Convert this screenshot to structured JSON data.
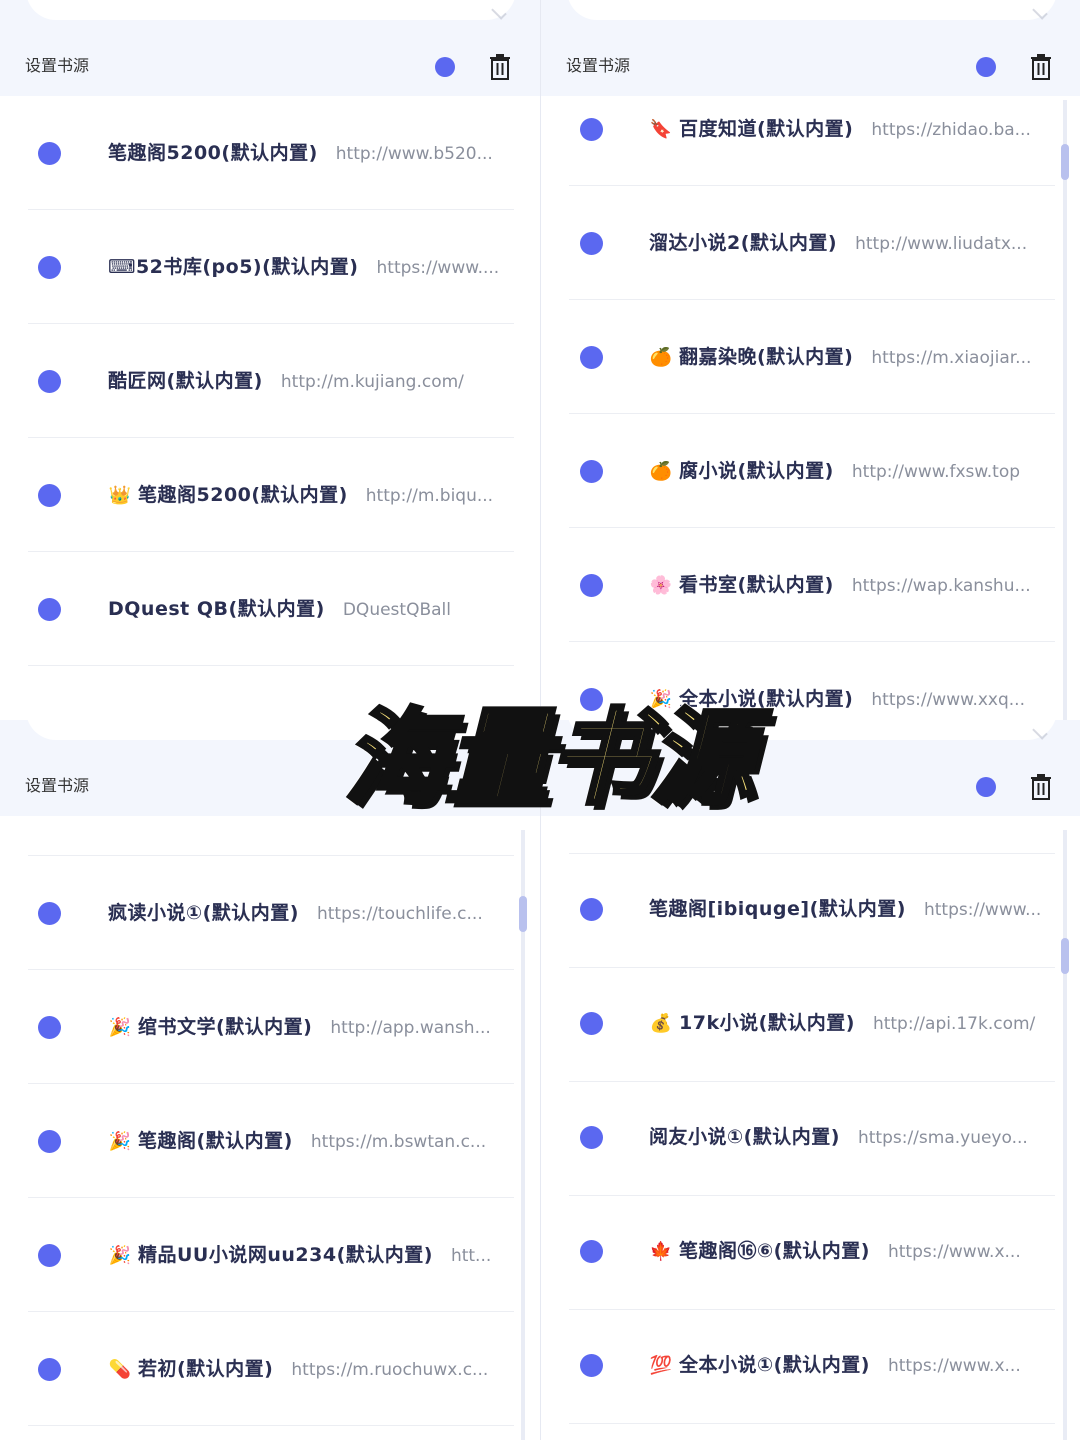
{
  "app": {
    "section_title": "设置书源"
  },
  "colors": {
    "accent": "#5b68f0",
    "header_bg": "#f3f6fd",
    "banner_fill": "#f9e27a"
  },
  "icons": {
    "delete": "trash-icon"
  },
  "banner": {
    "text": "海量书源"
  },
  "panels": [
    {
      "id": "top-left",
      "title": "设置书源",
      "rows": [
        {
          "icon": "",
          "name": "笔趣阁5200(默认内置)",
          "url": "http://www.b520..."
        },
        {
          "icon": "⌨",
          "name": "52书库(po5)(默认内置)",
          "url": "https://www...."
        },
        {
          "icon": "",
          "name": "酷匠网(默认内置)",
          "url": "http://m.kujiang.com/"
        },
        {
          "icon": "👑",
          "name": "笔趣阁5200(默认内置)",
          "url": "http://m.biqu..."
        },
        {
          "icon": "",
          "name": "DQuest QB(默认内置)",
          "url": "DQuestQBall"
        }
      ]
    },
    {
      "id": "top-right",
      "title": "设置书源",
      "rows": [
        {
          "icon": "🔖",
          "name": "百度知道(默认内置)",
          "url": "https://zhidao.ba..."
        },
        {
          "icon": "",
          "name": "溜达小说2(默认内置)",
          "url": "http://www.liudatx..."
        },
        {
          "icon": "🍊",
          "name": "翻嘉染晚(默认内置)",
          "url": "https://m.xiaojiar..."
        },
        {
          "icon": "🍊",
          "name": "腐小说(默认内置)",
          "url": "http://www.fxsw.top"
        },
        {
          "icon": "🌸",
          "name": "看书室(默认内置)",
          "url": "https://wap.kanshu..."
        },
        {
          "icon": "🎉",
          "name": "全本小说(默认内置)",
          "url": "https://www.xxq..."
        }
      ]
    },
    {
      "id": "bottom-left",
      "title": "设置书源",
      "rows": [
        {
          "icon": "",
          "name": "疯读小说①(默认内置)",
          "url": "https://touchlife.c..."
        },
        {
          "icon": "🎉",
          "name": "绾书文学(默认内置)",
          "url": "http://app.wansh..."
        },
        {
          "icon": "🎉",
          "name": "笔趣阁(默认内置)",
          "url": "https://m.bswtan.c..."
        },
        {
          "icon": "🎉",
          "name": "精品UU小说网uu234(默认内置)",
          "url": "htt..."
        },
        {
          "icon": "💊",
          "name": "若初(默认内置)",
          "url": "https://m.ruochuwx.c..."
        }
      ]
    },
    {
      "id": "bottom-right",
      "rows": [
        {
          "icon": "",
          "name": "笔趣阁[ibiquge](默认内置)",
          "url": "https://www..."
        },
        {
          "icon": "💰",
          "name": "17k小说(默认内置)",
          "url": "http://api.17k.com/"
        },
        {
          "icon": "",
          "name": "阅友小说①(默认内置)",
          "url": "https://sma.yueyo..."
        },
        {
          "icon": "🍁",
          "name": "笔趣阁⑯⑥(默认内置)",
          "url": "https://www.x..."
        },
        {
          "icon": "💯",
          "name": "全本小说①(默认内置)",
          "url": "https://www.x..."
        }
      ]
    }
  ]
}
